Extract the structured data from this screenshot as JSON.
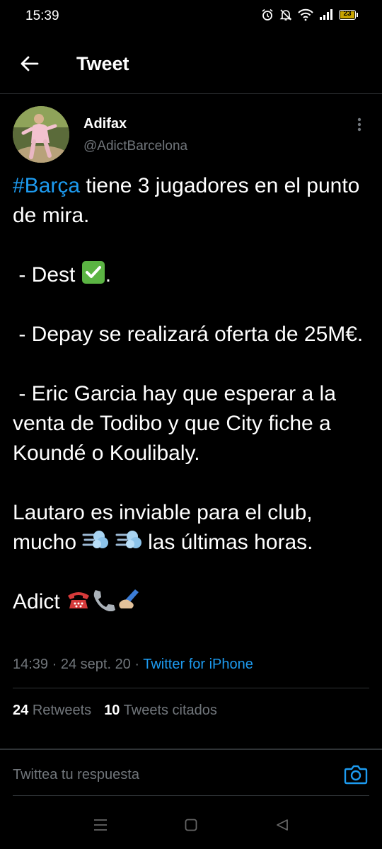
{
  "status_bar": {
    "time": "15:39",
    "battery": "23"
  },
  "header": {
    "title": "Tweet"
  },
  "author": {
    "name": "Adifax",
    "handle": "@AdictBarcelona"
  },
  "tweet": {
    "hashtag": "#Barça",
    "line1_rest": " tiene 3 jugadores en el punto de mira.",
    "dest_text": " - Dest ",
    "dest_suffix": ".",
    "depay": " - Depay se realizará oferta de 25M€.",
    "eric": " - Eric Garcia hay que esperar a la venta de Todibo y que City fiche a Koundé o Koulibaly.",
    "lautaro_a": "Lautaro es inviable para el club, mucho ",
    "lautaro_b": " las últimas horas.",
    "signoff": "Adict "
  },
  "meta": {
    "time": "14:39",
    "date": "24 sept. 20",
    "separator": " · ",
    "source": "Twitter for iPhone"
  },
  "stats": {
    "retweets_count": "24",
    "retweets_label": "Retweets",
    "quotes_count": "10",
    "quotes_label": "Tweets citados"
  },
  "reply": {
    "placeholder": "Twittea tu respuesta"
  },
  "colors": {
    "accent": "#1d9bf0",
    "muted": "#71767b",
    "divider": "#2f3336",
    "background": "#000000"
  },
  "icons": [
    "alarm-icon",
    "mute-bell-icon",
    "wifi-icon",
    "signal-icon",
    "battery-icon",
    "back-arrow-icon",
    "more-vertical-icon",
    "check-mark-emoji-icon",
    "dash-emoji-icon",
    "telephone-emoji-icon",
    "phone-receiver-emoji-icon",
    "writing-hand-emoji-icon",
    "camera-icon",
    "menu-nav-icon",
    "home-nav-icon",
    "back-nav-icon"
  ]
}
